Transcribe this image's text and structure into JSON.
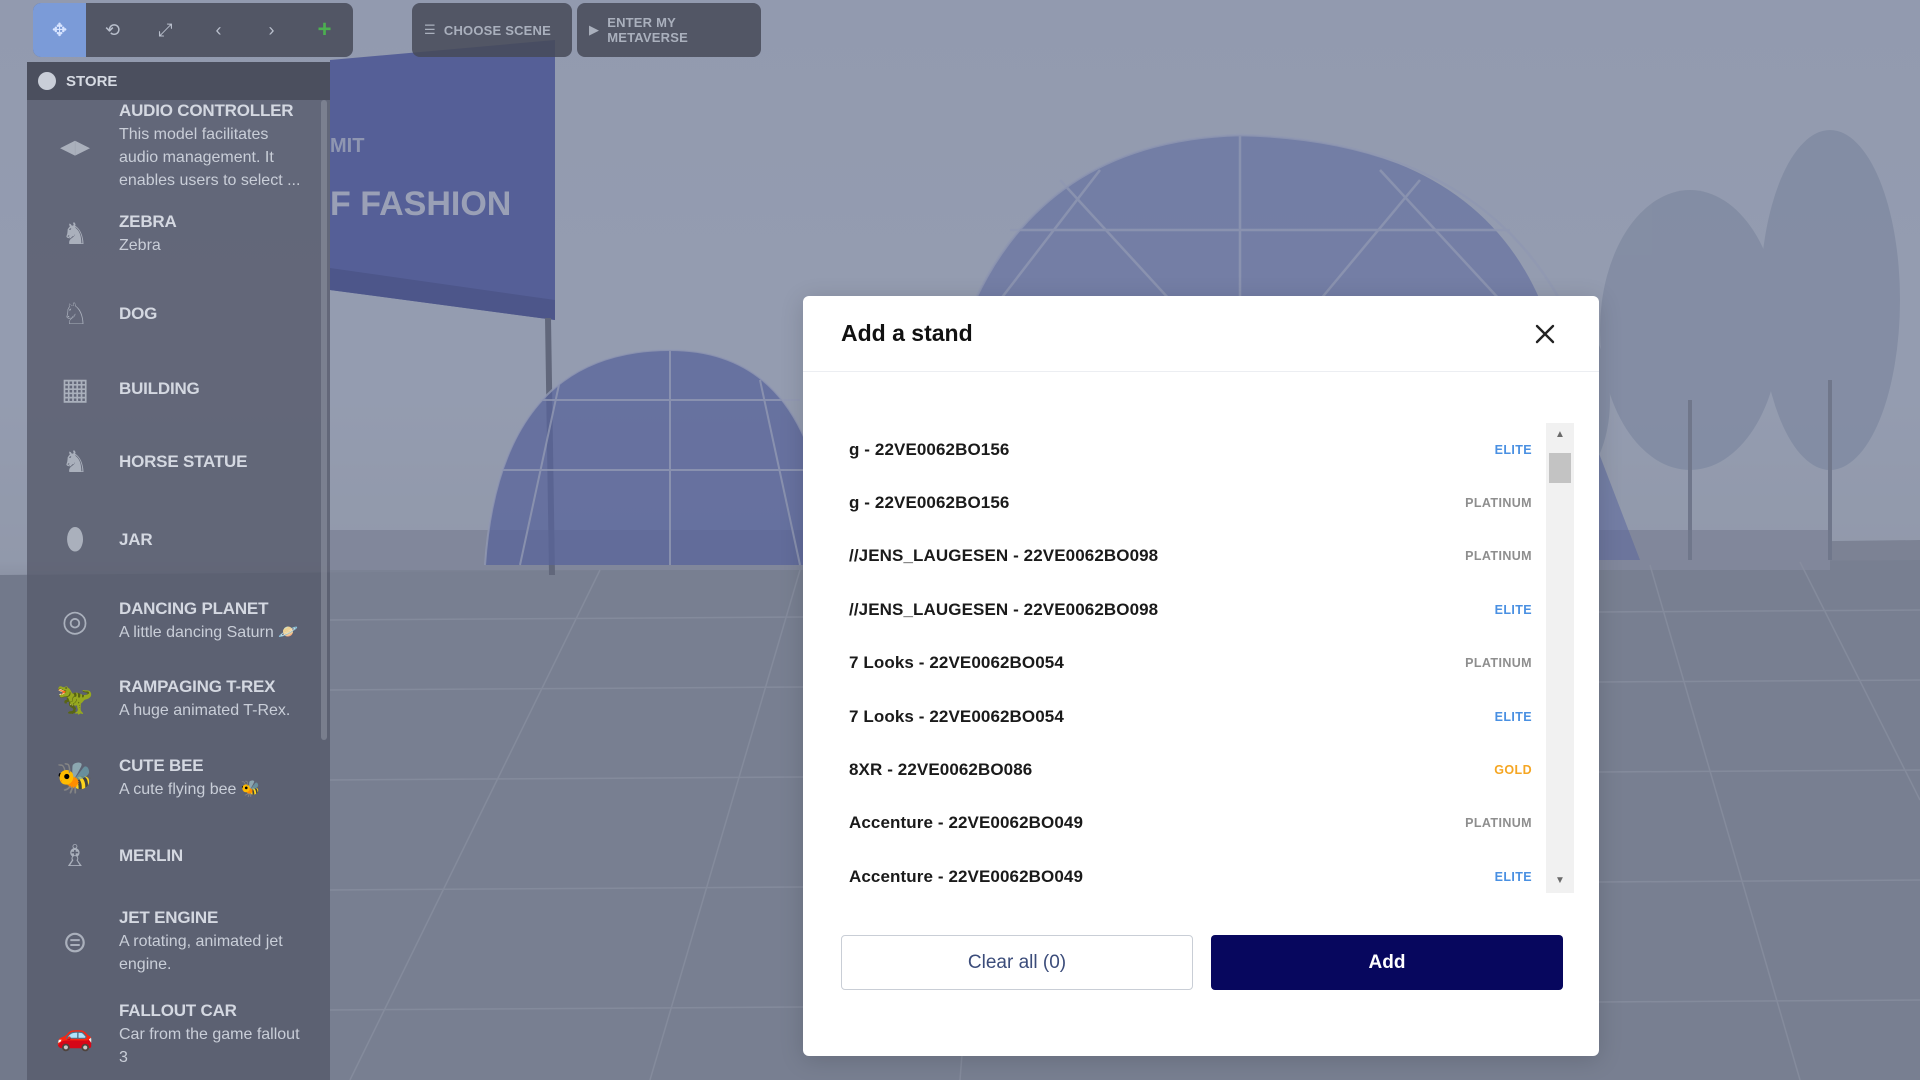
{
  "toolbar": {
    "tools": [
      {
        "icon": "move-icon",
        "glyph": "✥"
      },
      {
        "icon": "rotate-icon",
        "glyph": "⟲"
      },
      {
        "icon": "scale-icon",
        "glyph": "⤢"
      },
      {
        "icon": "chevron-left-icon",
        "glyph": "‹"
      },
      {
        "icon": "chevron-right-icon",
        "glyph": "›"
      },
      {
        "icon": "plus-icon",
        "glyph": "+"
      }
    ],
    "choose_scene_label": "CHOOSE SCENE",
    "enter_metaverse_label": "ENTER MY METAVERSE"
  },
  "scene": {
    "banner_fragment_1": "MIT",
    "banner_fragment_2": "F FASHION"
  },
  "store": {
    "title": "STORE",
    "items": [
      {
        "name": "AUDIO CONTROLLER",
        "desc": "This model facilitates audio management. It enables users to select ...",
        "icon": "speaker-icon",
        "glyph": "◂▸"
      },
      {
        "name": "ZEBRA",
        "desc": "Zebra",
        "icon": "zebra-icon",
        "glyph": "♞"
      },
      {
        "name": "DOG",
        "desc": "",
        "icon": "dog-icon",
        "glyph": "♘"
      },
      {
        "name": "BUILDING",
        "desc": "",
        "icon": "building-icon",
        "glyph": "▦"
      },
      {
        "name": "HORSE STATUE",
        "desc": "",
        "icon": "horse-statue-icon",
        "glyph": "♞"
      },
      {
        "name": "JAR",
        "desc": "",
        "icon": "jar-icon",
        "glyph": "⬮"
      },
      {
        "name": "DANCING PLANET",
        "desc": "A little dancing Saturn 🪐",
        "icon": "planet-icon",
        "glyph": "◎"
      },
      {
        "name": "RAMPAGING T-REX",
        "desc": "A huge animated T-Rex.",
        "icon": "trex-icon",
        "glyph": "🦖"
      },
      {
        "name": "CUTE BEE",
        "desc": "A cute flying bee 🐝",
        "icon": "bee-icon",
        "glyph": "🐝"
      },
      {
        "name": "MERLIN",
        "desc": "",
        "icon": "merlin-icon",
        "glyph": "♗"
      },
      {
        "name": "JET ENGINE",
        "desc": "A rotating, animated jet engine.",
        "icon": "jet-engine-icon",
        "glyph": "⊜"
      },
      {
        "name": "FALLOUT CAR",
        "desc": "Car from the game fallout 3",
        "icon": "car-icon",
        "glyph": "🚗"
      }
    ]
  },
  "modal": {
    "title": "Add a stand",
    "stands": [
      {
        "name": "g - 22VE0062BO156",
        "tier": "ELITE"
      },
      {
        "name": "g - 22VE0062BO156",
        "tier": "PLATINUM"
      },
      {
        "name": "//JENS_LAUGESEN - 22VE0062BO098",
        "tier": "PLATINUM"
      },
      {
        "name": "//JENS_LAUGESEN - 22VE0062BO098",
        "tier": "ELITE"
      },
      {
        "name": "7 Looks - 22VE0062BO054",
        "tier": "PLATINUM"
      },
      {
        "name": "7 Looks - 22VE0062BO054",
        "tier": "ELITE"
      },
      {
        "name": "8XR - 22VE0062BO086",
        "tier": "GOLD"
      },
      {
        "name": "Accenture - 22VE0062BO049",
        "tier": "PLATINUM"
      },
      {
        "name": "Accenture - 22VE0062BO049",
        "tier": "ELITE"
      }
    ],
    "clear_label": "Clear all (0)",
    "add_label": "Add"
  },
  "colors": {
    "elite": "#4a90e2",
    "platinum": "#8e8e8e",
    "gold": "#f5a623",
    "add_button": "#07075e"
  }
}
